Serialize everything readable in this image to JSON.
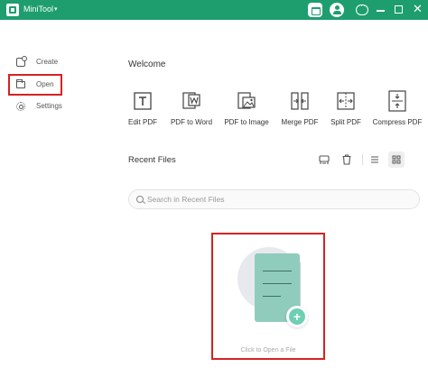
{
  "titlebar": {
    "app_name": "MiniTool",
    "caret": "▾",
    "icons": [
      "store-icon",
      "user-icon",
      "chat-icon"
    ],
    "window_controls": [
      "minimize",
      "maximize",
      "close"
    ],
    "close_glyph": "✕",
    "accent_color": "#1e9e6e"
  },
  "sidebar": {
    "items": [
      {
        "label": "Create",
        "icon": "create-icon"
      },
      {
        "label": "Open",
        "icon": "folder-icon",
        "highlighted": true
      },
      {
        "label": "Settings",
        "icon": "gear-icon"
      }
    ],
    "highlight_color": "#d62222"
  },
  "main": {
    "welcome": "Welcome",
    "tools": [
      {
        "label": "Edit PDF",
        "icon": "text-edit-icon"
      },
      {
        "label": "PDF to Word",
        "icon": "word-convert-icon"
      },
      {
        "label": "PDF to Image",
        "icon": "image-convert-icon"
      },
      {
        "label": "Merge PDF",
        "icon": "merge-icon"
      },
      {
        "label": "Split PDF",
        "icon": "split-icon"
      },
      {
        "label": "Compress PDF",
        "icon": "compress-icon"
      }
    ],
    "recent": {
      "title": "Recent Files",
      "toolbar_icons": [
        "clean-icon",
        "trash-icon",
        "list-view-icon",
        "grid-view-icon"
      ],
      "active_view": "grid"
    },
    "search": {
      "placeholder": "Search in Recent Files",
      "value": ""
    },
    "open_area": {
      "caption": "Click to Open a File",
      "plus": "+"
    }
  }
}
